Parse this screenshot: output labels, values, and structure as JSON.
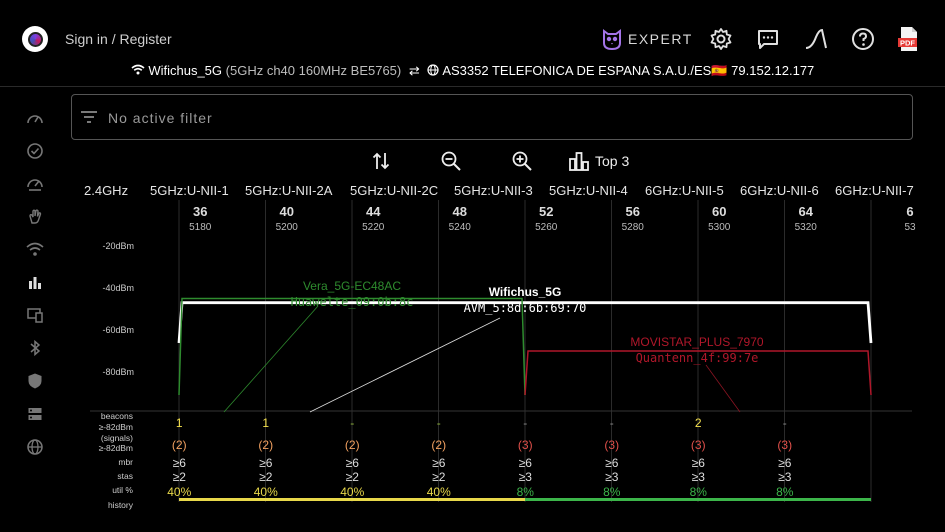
{
  "header": {
    "signin_label": "Sign in / Register",
    "expert_label": "EXPERT",
    "pdf_label": "PDF"
  },
  "connection": {
    "ssid": "Wifichus_5G",
    "details": "(5GHz ch40 160MHz BE5765)",
    "isp": "AS3352 TELEFONICA DE ESPANA S.A.U./ES",
    "flag": "🇪🇸",
    "ip": "79.152.12.177"
  },
  "filter": {
    "text": "No active filter"
  },
  "toolbar": {
    "top_label": "Top 3"
  },
  "bands": [
    "2.4GHz",
    "5GHz:U-NII-1",
    "5GHz:U-NII-2A",
    "5GHz:U-NII-2C",
    "5GHz:U-NII-3",
    "5GHz:U-NII-4",
    "6GHz:U-NII-5",
    "6GHz:U-NII-6",
    "6GHz:U-NII-7"
  ],
  "chart_data": {
    "type": "spectrum",
    "y_ticks": [
      "-20dBm",
      "-40dBm",
      "-60dBm",
      "-80dBm"
    ],
    "ylim": [
      -100,
      -10
    ],
    "channels": [
      {
        "ch": "36",
        "freq": "5180"
      },
      {
        "ch": "40",
        "freq": "5200"
      },
      {
        "ch": "44",
        "freq": "5220"
      },
      {
        "ch": "48",
        "freq": "5240"
      },
      {
        "ch": "52",
        "freq": "5260"
      },
      {
        "ch": "56",
        "freq": "5280"
      },
      {
        "ch": "60",
        "freq": "5300"
      },
      {
        "ch": "64",
        "freq": "5320"
      },
      {
        "ch": "6",
        "freq": "53"
      }
    ],
    "networks": [
      {
        "name": "Wifichus_5G",
        "label2": "AVM_5:8d:6b:69:70",
        "from_ch": 0,
        "to_ch": 8,
        "dbm": -47,
        "color": "#ffffff"
      },
      {
        "name": "Vera_5G-EC48AC",
        "label2": "Huawelte_09:0b:8c",
        "from_ch": 0,
        "to_ch": 4,
        "dbm": -45,
        "color": "#2e8b2e"
      },
      {
        "name": "MOVISTAR_PLUS_7970",
        "label2": "Quantenn_4f:99:7e",
        "from_ch": 4,
        "to_ch": 8,
        "dbm": -70,
        "color": "#b0172a"
      }
    ],
    "row_labels": [
      "beacons",
      "≥-82dBm",
      "(signals)",
      "≥-82dBm",
      "mbr",
      "stas",
      "util %",
      "history"
    ],
    "stats": [
      {
        "beacons": "1",
        "signals": "(2)",
        "mbr": "≥6",
        "stas": "≥2",
        "util": "40%"
      },
      {
        "beacons": "1",
        "signals": "(2)",
        "mbr": "≥6",
        "stas": "≥2",
        "util": "40%"
      },
      {
        "beacons": "-",
        "signals": "(2)",
        "mbr": "≥6",
        "stas": "≥2",
        "util": "40%"
      },
      {
        "beacons": "-",
        "signals": "(2)",
        "mbr": "≥6",
        "stas": "≥2",
        "util": "40%"
      },
      {
        "beacons": "-",
        "signals": "(3)",
        "mbr": "≥6",
        "stas": "≥3",
        "util": "8%"
      },
      {
        "beacons": "-",
        "signals": "(3)",
        "mbr": "≥6",
        "stas": "≥3",
        "util": "8%"
      },
      {
        "beacons": "2",
        "signals": "(3)",
        "mbr": "≥6",
        "stas": "≥3",
        "util": "8%"
      },
      {
        "beacons": "-",
        "signals": "(3)",
        "mbr": "≥6",
        "stas": "≥3",
        "util": "8%"
      }
    ],
    "colors": {
      "yellow": "#f4e04d",
      "green": "#2fb24c",
      "orange": "#f0a060",
      "red": "#e0504a",
      "util_high": "#e8d84a",
      "util_low": "#3cb54a"
    }
  }
}
